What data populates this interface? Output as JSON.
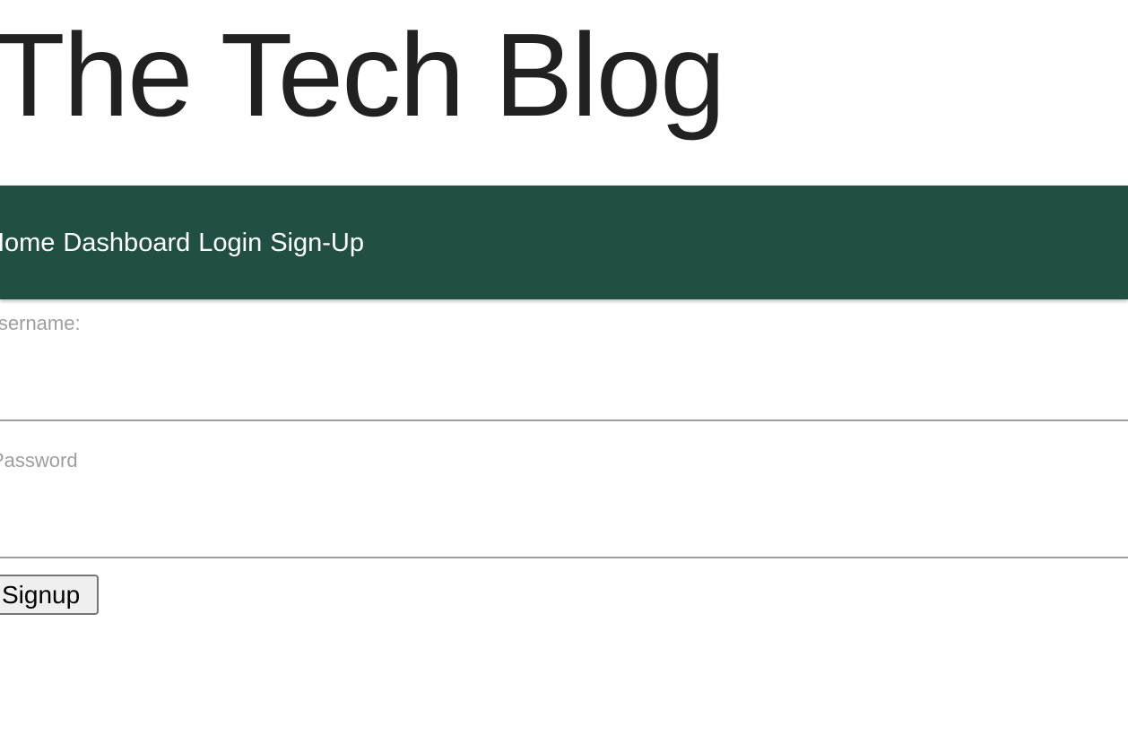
{
  "header": {
    "title": "The Tech Blog"
  },
  "nav": {
    "items": [
      {
        "label": "Home"
      },
      {
        "label": "Dashboard"
      },
      {
        "label": "Login"
      },
      {
        "label": "Sign-Up"
      }
    ]
  },
  "form": {
    "username_label": "Username:",
    "username_value": "",
    "password_label": "Password",
    "password_value": "",
    "submit_label": "Signup"
  },
  "colors": {
    "navbar_bg": "#214f43",
    "title_text": "#212121",
    "label_text": "#9e9e9e"
  }
}
